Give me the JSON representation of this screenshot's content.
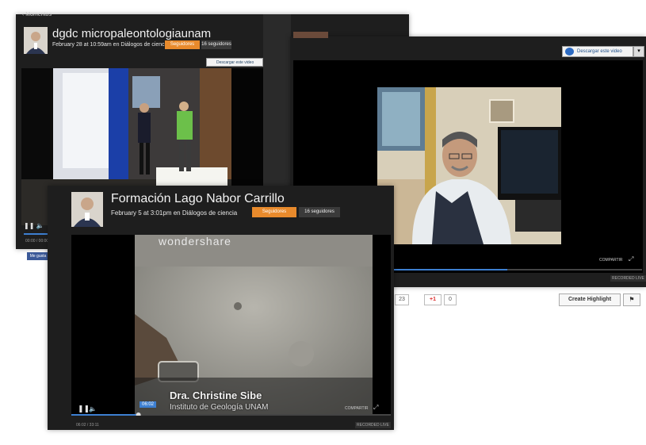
{
  "panel_a": {
    "breadcrumb": "‹ Momentos",
    "title": "dgdc micropaleontologiaunam",
    "date": "February 28 at 10:59am",
    "meta_in": "en",
    "channel": "Diálogos de ciencia",
    "follow_label": "Seguidores",
    "followers": "16 seguidores",
    "download_label": "Descargar este video",
    "time": "00:00 / 00:00",
    "fb_label": "Me gusta"
  },
  "panel_b": {
    "download_label": "Descargar este video",
    "share_label": "COMPARTIR",
    "recorded_label": "RECORDED LIVE",
    "count_a": "23",
    "gplus_label": "+1",
    "gplus_count": "0",
    "highlight_label": "Create Highlight"
  },
  "panel_c": {
    "title": "Formación Lago Nabor Carrillo",
    "date": "February 5 at 3:01pm",
    "meta_in": "en",
    "channel": "Diálogos de ciencia",
    "follow_label": "Seguidores",
    "followers": "16 seguidores",
    "watermark": "wondershare",
    "caption_name": "Dra. Christine Sibe",
    "caption_inst": "Instituto de Geología UNAM",
    "time_badge": "06:02",
    "time": "06:02 / 33:11",
    "share_label": "COMPARTIR",
    "recorded_label": "RECORDED LIVE"
  },
  "icons": [
    "avatar-icon",
    "pause-icon",
    "volume-icon",
    "fullscreen-icon",
    "download-icon",
    "chevron-down-icon",
    "flag-icon"
  ],
  "colors": {
    "follow": "#e88a2c",
    "progress": "#3d7fd1",
    "panel": "#1e1e1e",
    "fb": "#3b5998"
  },
  "progress": {
    "panel_a": 0.2,
    "panel_b": 0.46,
    "panel_c": 0.21
  }
}
